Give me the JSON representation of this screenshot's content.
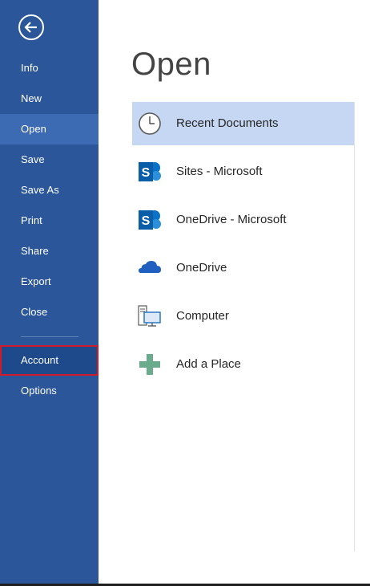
{
  "sidebar": {
    "back_label": "Back",
    "items": [
      {
        "label": "Info"
      },
      {
        "label": "New"
      },
      {
        "label": "Open"
      },
      {
        "label": "Save"
      },
      {
        "label": "Save As"
      },
      {
        "label": "Print"
      },
      {
        "label": "Share"
      },
      {
        "label": "Export"
      },
      {
        "label": "Close"
      },
      {
        "label": "Account"
      },
      {
        "label": "Options"
      }
    ],
    "selected_item": "Open",
    "highlighted_item": "Account"
  },
  "main": {
    "title": "Open",
    "places": [
      {
        "label": "Recent Documents",
        "icon": "clock-icon"
      },
      {
        "label": "Sites - Microsoft",
        "icon": "sharepoint-icon"
      },
      {
        "label": "OneDrive - Microsoft",
        "icon": "sharepoint-icon"
      },
      {
        "label": "OneDrive",
        "icon": "cloud-icon"
      },
      {
        "label": "Computer",
        "icon": "computer-icon"
      },
      {
        "label": "Add a Place",
        "icon": "plus-icon"
      }
    ]
  },
  "colors": {
    "sidebar_bg": "#2b579a",
    "selected_nav_bg": "#3d6bb3",
    "selected_place_bg": "#c5d7f2",
    "highlight_border": "#d11a2a"
  }
}
